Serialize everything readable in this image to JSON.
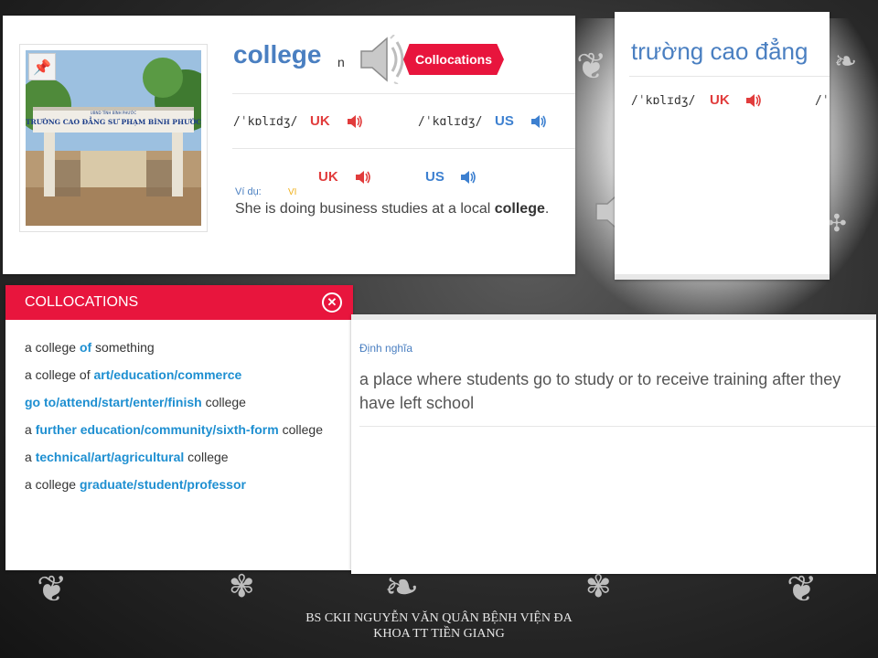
{
  "main_card": {
    "word": "college",
    "pos": "n",
    "collocations_button": "Collocations",
    "uk_ipa": "/ˈkɒlɪdʒ/",
    "uk_label": "UK",
    "us_ipa": "/ˈkɑlɪdʒ/",
    "us_label": "US",
    "example_label": "Ví dụ:",
    "vi_tag": "VI",
    "example_uk_label": "UK",
    "example_us_label": "US",
    "example_prefix": "She is doing business studies at a local ",
    "example_keyword": "college",
    "example_suffix": ".",
    "photo_sign": "TRƯỜNG CAO ĐẲNG SƯ PHẠM BÌNH PHƯỚC",
    "photo_sign_top": "UBND TỈNH BÌNH PHƯỚC"
  },
  "vi_card": {
    "word": "trường cao đẳng",
    "uk_ipa": "/ˈkɒlɪdʒ/",
    "uk_label": "UK",
    "us_ipa_partial": "/ˈ"
  },
  "collocations": {
    "title": "COLLOCATIONS",
    "items": [
      {
        "parts": [
          {
            "t": "a college ",
            "h": false
          },
          {
            "t": "of",
            "h": true
          },
          {
            "t": " something",
            "h": false
          }
        ]
      },
      {
        "parts": [
          {
            "t": "a college of ",
            "h": false
          },
          {
            "t": "art/education/commerce",
            "h": true
          }
        ]
      },
      {
        "parts": [
          {
            "t": "go to/attend/start/enter/finish",
            "h": true
          },
          {
            "t": " college",
            "h": false
          }
        ]
      },
      {
        "parts": [
          {
            "t": "a ",
            "h": false
          },
          {
            "t": "further education/community/sixth-form",
            "h": true
          },
          {
            "t": " college",
            "h": false
          }
        ]
      },
      {
        "parts": [
          {
            "t": "a ",
            "h": false
          },
          {
            "t": "technical/art/agricultural",
            "h": true
          },
          {
            "t": " college",
            "h": false
          }
        ]
      },
      {
        "parts": [
          {
            "t": "a college ",
            "h": false
          },
          {
            "t": "graduate/student/professor",
            "h": true
          }
        ]
      }
    ]
  },
  "definition": {
    "label": "Định nghĩa",
    "text": "a place where students go to study or to receive training after they have left school"
  },
  "footer": {
    "line1": "BS CKII NGUYỄN VĂN QUÂN BỆNH VIỆN ĐA",
    "line2": "KHOA TT TIỀN GIANG"
  },
  "colors": {
    "accent_red": "#e8153d",
    "word_blue": "#4a7fc1",
    "uk_red": "#e13c3c",
    "us_blue": "#3d80d0",
    "highlight_blue": "#1e8fd1"
  },
  "icons": [
    "pin-icon",
    "speaker-icon",
    "sound-icon",
    "close-icon"
  ]
}
